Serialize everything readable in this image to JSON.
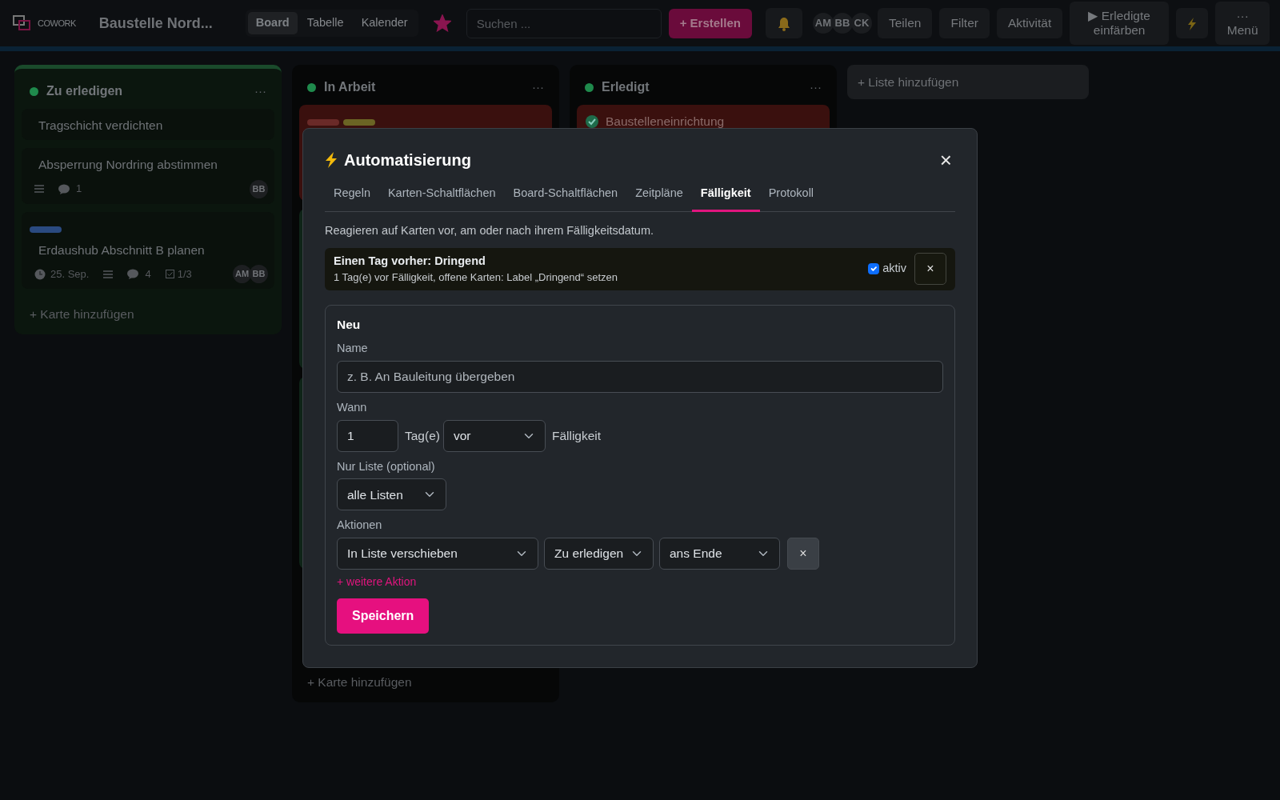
{
  "header": {
    "logo_text": "COWORK",
    "board_title": "Baustelle Nord...",
    "starred": true,
    "views": [
      {
        "label": "Board",
        "selected": true
      },
      {
        "label": "Tabelle",
        "selected": false
      },
      {
        "label": "Kalender",
        "selected": false
      }
    ],
    "search": {
      "placeholder": "Suchen ..."
    },
    "create_button": "+ Erstellen",
    "members": [
      "AM",
      "BB",
      "CK"
    ],
    "buttons": [
      {
        "kind": "text",
        "label": "Teilen"
      },
      {
        "kind": "text",
        "label": "Filter"
      },
      {
        "kind": "text",
        "label": "Aktivität"
      },
      {
        "kind": "wrap",
        "label": "▶ Erledigte einfärben"
      },
      {
        "kind": "bolt"
      },
      {
        "kind": "stack",
        "icon": "···",
        "label": "Menü"
      }
    ]
  },
  "lists": [
    {
      "title": "Zu erledigen",
      "color": "#1f8a4c",
      "highlighted": true,
      "menu": "···",
      "cards": [
        {
          "title": "Tragschicht verdichten"
        },
        {
          "title": "Absperrung Nordring abstimmen",
          "description": true,
          "comments": "1",
          "members": [
            "BB"
          ]
        },
        {
          "labels": [
            {
              "color": "#2a4a80"
            }
          ],
          "title": "Erdaushub Abschnitt B planen",
          "due": "25. Sep.",
          "description": true,
          "comments": "4",
          "checklist": "1/3",
          "members": [
            "AM",
            "BB"
          ]
        }
      ],
      "add_card": "+ Karte hinzufügen"
    },
    {
      "title": "In Arbeit",
      "color": "#1f8a4c",
      "highlighted": false,
      "menu": "···",
      "cards": [
        {
          "labels": [
            {
              "color": "#6a2a28"
            },
            {
              "color": "#6b6424"
            }
          ],
          "color": "#3a100e"
        },
        {
          "color": "#0f2418"
        },
        {
          "color": "#0f2418"
        }
      ],
      "add_card": "+ Karte hinzufügen"
    },
    {
      "title": "Erledigt",
      "color": "#1f8a4c",
      "highlighted": false,
      "menu": "···",
      "cards": [
        {
          "title": "Baustelleneinrichtung",
          "done": true,
          "color": "#3a100e"
        }
      ]
    }
  ],
  "add_list": "+ Liste hinzufügen",
  "modal": {
    "title": "Automatisierung",
    "close": "×",
    "tabs": [
      {
        "label": "Regeln",
        "selected": false
      },
      {
        "label": "Karten-Schaltflächen",
        "selected": false
      },
      {
        "label": "Board-Schaltflächen",
        "selected": false
      },
      {
        "label": "Zeitpläne",
        "selected": false
      },
      {
        "label": "Fälligkeit",
        "selected": true
      },
      {
        "label": "Protokoll",
        "selected": false
      }
    ],
    "description": "Reagieren auf Karten vor, am oder nach ihrem Fälligkeitsdatum.",
    "rules": [
      {
        "title": "Einen Tag vorher: Dringend",
        "summary": "1 Tag(e) vor Fälligkeit, offene Karten: Label „Dringend“ setzen",
        "active": true,
        "active_label": "aktiv",
        "delete": "×"
      }
    ],
    "form": {
      "heading": "Neu",
      "name": {
        "label": "Name",
        "placeholder": "z. B. An Bauleitung übergeben"
      },
      "when": {
        "label": "Wann",
        "days": "1",
        "unit": "Tag(e)",
        "direction": "vor",
        "suffix": "Fälligkeit"
      },
      "list_filter": {
        "label": "Nur Liste (optional)",
        "value": "alle Listen"
      },
      "actions_label": "Aktionen",
      "actions": [
        {
          "type": "In Liste verschieben",
          "list": "Zu erledigen",
          "position": "ans Ende",
          "remove": "×"
        }
      ],
      "add_action": "+ weitere Aktion",
      "save": "Speichern"
    }
  }
}
